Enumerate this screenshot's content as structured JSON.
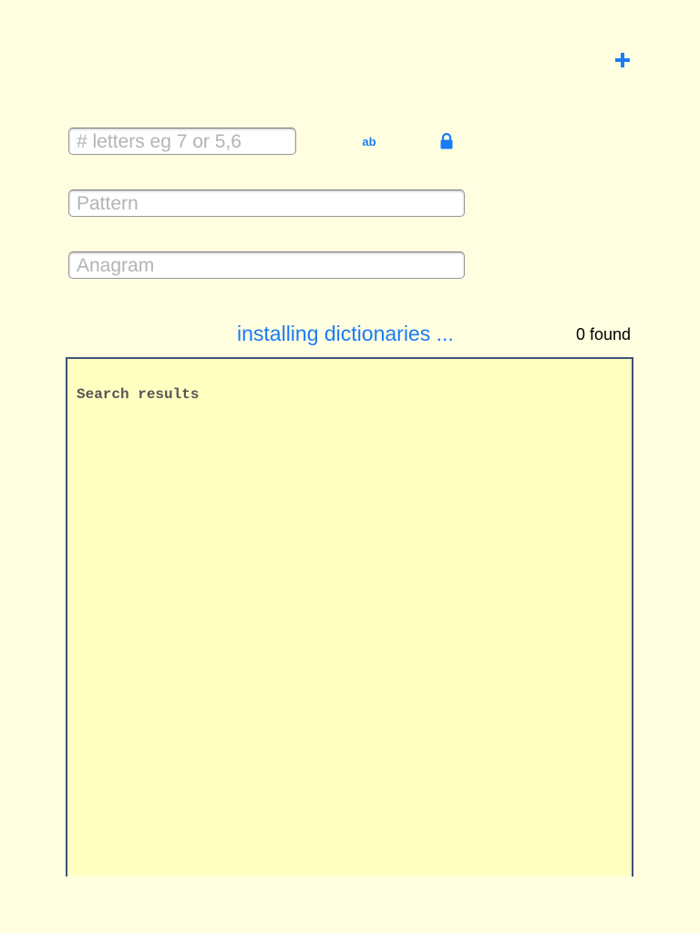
{
  "toolbar": {
    "add_icon": "plus-icon",
    "accent_color": "#1a7cf5"
  },
  "search": {
    "letters_placeholder": "# letters eg 7 or 5,6",
    "letters_value": "",
    "ab_toggle_label": "ab",
    "lock_icon": "lock-icon",
    "pattern_placeholder": "Pattern",
    "pattern_value": "",
    "anagram_placeholder": "Anagram",
    "anagram_value": ""
  },
  "status": {
    "message": "installing dictionaries ...",
    "found_count": "0 found"
  },
  "results": {
    "label": "Search results",
    "background_color": "#ffffc2",
    "border_color": "#3d5377"
  },
  "colors": {
    "page_background": "#fffee1"
  }
}
